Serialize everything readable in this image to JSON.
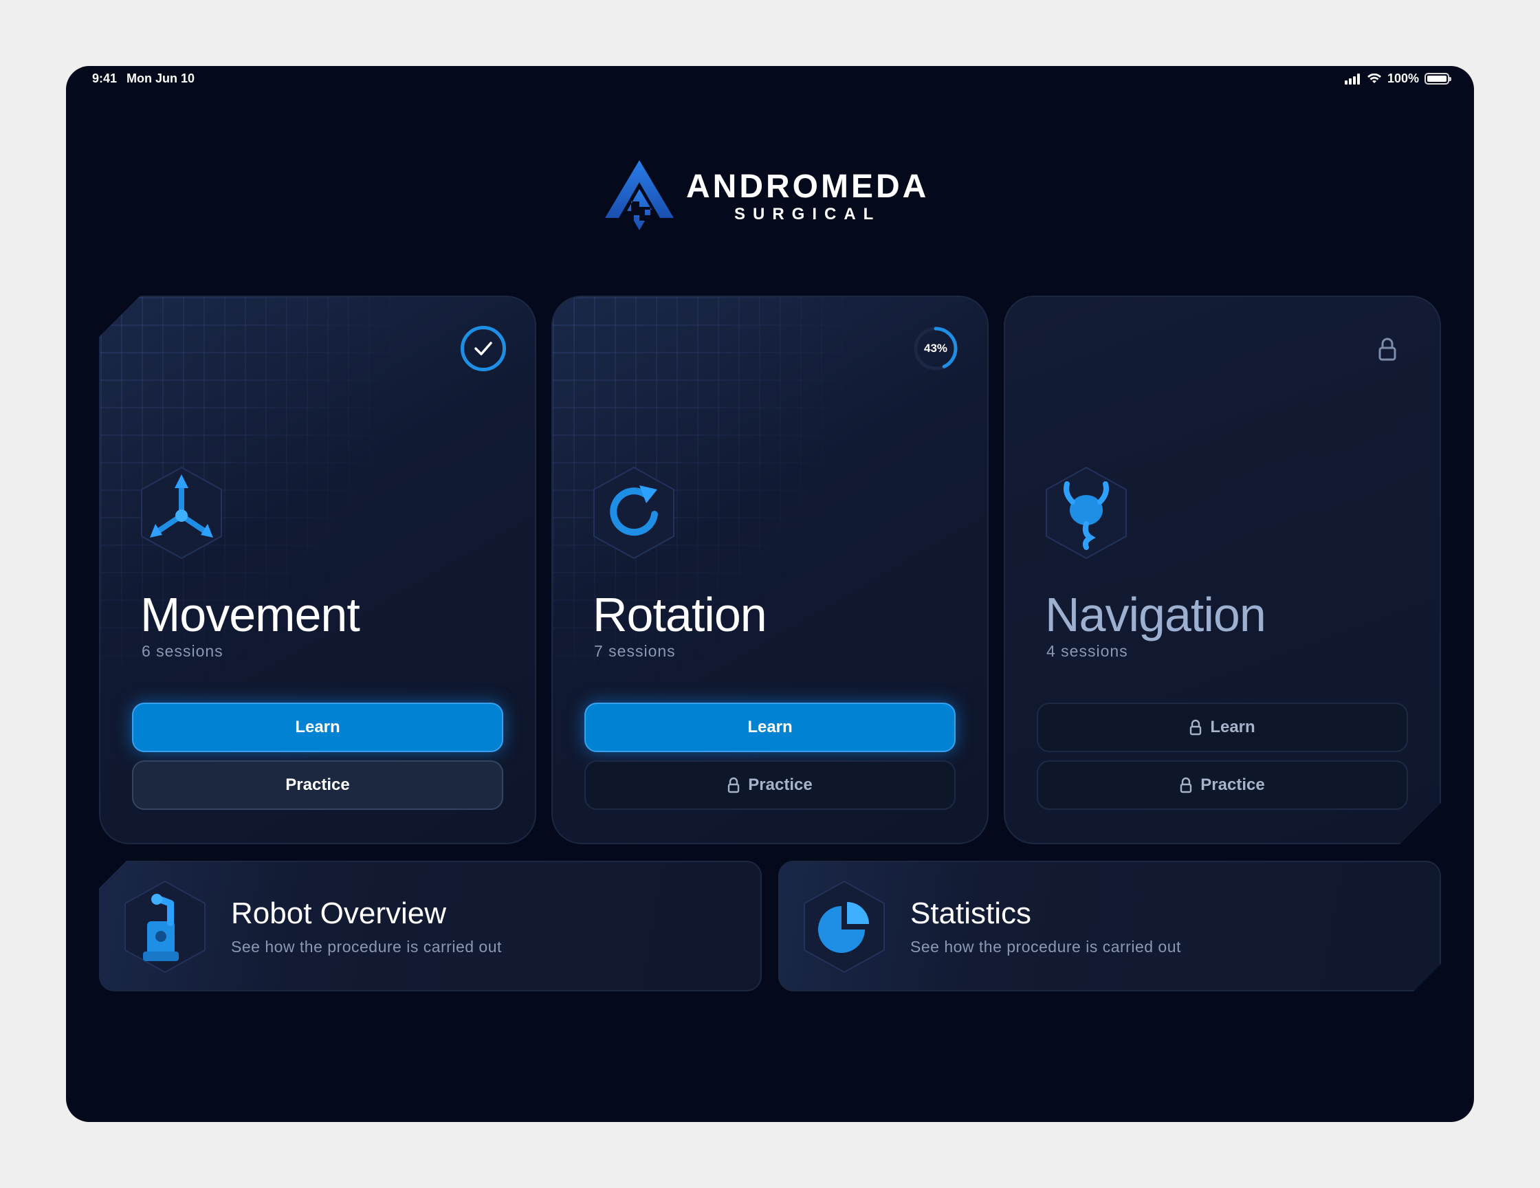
{
  "status_bar": {
    "time": "9:41",
    "date": "Mon Jun 10",
    "battery_text": "100%",
    "icons": [
      "cellular-signal-icon",
      "wifi-icon",
      "battery-icon"
    ]
  },
  "brand": {
    "name": "ANDROMEDA",
    "subtitle": "SURGICAL",
    "accent_color": "#1f6fe0"
  },
  "modules": [
    {
      "title": "Movement",
      "sessions": "6 sessions",
      "status": "completed",
      "status_icon": "checkmark-icon",
      "icon": "axes-arrows-icon",
      "learn_label": "Learn",
      "practice_label": "Practice",
      "learn_locked": false,
      "practice_locked": false
    },
    {
      "title": "Rotation",
      "sessions": "7 sessions",
      "status": "in-progress",
      "progress_text": "43%",
      "progress": 0.43,
      "icon": "rotate-arrow-icon",
      "learn_label": "Learn",
      "practice_label": "Practice",
      "learn_locked": false,
      "practice_locked": true
    },
    {
      "title": "Navigation",
      "sessions": "4 sessions",
      "status": "locked",
      "status_icon": "lock-icon",
      "icon": "bladder-organ-icon",
      "learn_label": "Learn",
      "practice_label": "Practice",
      "learn_locked": true,
      "practice_locked": true
    }
  ],
  "tiles": [
    {
      "title": "Robot Overview",
      "subtitle": "See how the procedure is carried out",
      "icon": "robot-arm-icon"
    },
    {
      "title": "Statistics",
      "subtitle": "See how the procedure is carried out",
      "icon": "pie-chart-icon"
    }
  ],
  "colors": {
    "background": "#040a1b",
    "primary_button": "#0282d3",
    "accent_blue": "#1f8fe6"
  }
}
